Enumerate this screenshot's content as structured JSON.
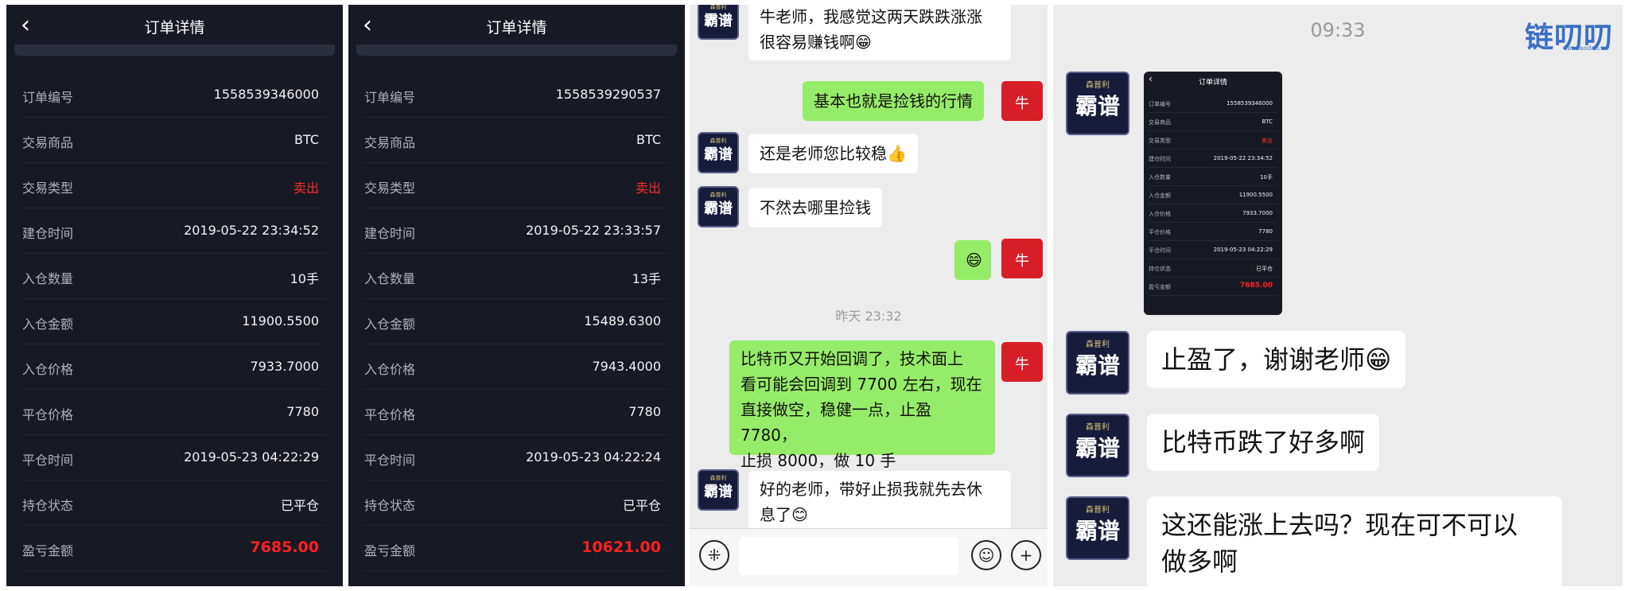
{
  "order1": {
    "back_icon": "chevron-left-icon",
    "title": "订单详情",
    "rows": [
      {
        "k": "订单编号",
        "v": "1558539346000"
      },
      {
        "k": "交易商品",
        "v": "BTC"
      },
      {
        "k": "交易类型",
        "v": "卖出"
      },
      {
        "k": "建仓时间",
        "v": "2019-05-22 23:34:52"
      },
      {
        "k": "入仓数量",
        "v": "10手"
      },
      {
        "k": "入仓金额",
        "v": "11900.5500"
      },
      {
        "k": "入仓价格",
        "v": "7933.7000"
      },
      {
        "k": "平仓价格",
        "v": "7780"
      },
      {
        "k": "平仓时间",
        "v": "2019-05-23 04:22:29"
      },
      {
        "k": "持仓状态",
        "v": "已平仓"
      },
      {
        "k": "盈亏金额",
        "v": "7685.00"
      }
    ]
  },
  "order2": {
    "back_icon": "chevron-left-icon",
    "title": "订单详情",
    "rows": [
      {
        "k": "订单编号",
        "v": "1558539290537"
      },
      {
        "k": "交易商品",
        "v": "BTC"
      },
      {
        "k": "交易类型",
        "v": "卖出"
      },
      {
        "k": "建仓时间",
        "v": "2019-05-22 23:33:57"
      },
      {
        "k": "入仓数量",
        "v": "13手"
      },
      {
        "k": "入仓金额",
        "v": "15489.6300"
      },
      {
        "k": "入仓价格",
        "v": "7943.4000"
      },
      {
        "k": "平仓价格",
        "v": "7780"
      },
      {
        "k": "平仓时间",
        "v": "2019-05-23 04:22:24"
      },
      {
        "k": "持仓状态",
        "v": "已平仓"
      },
      {
        "k": "盈亏金额",
        "v": "10621.00"
      }
    ]
  },
  "chat3": {
    "avatar_text": "霸谱",
    "avatar_sub": "森普利",
    "bot_icon": "牛",
    "messages": [
      {
        "l1": "牛老师，我感觉这两天跌跌涨涨",
        "l2": "很容易赚钱啊😁"
      },
      {
        "text": "基本也就是捡钱的行情"
      },
      {
        "text": "还是老师您比较稳👍"
      },
      {
        "text": "不然去哪里捡钱"
      },
      {
        "text": "😄"
      },
      {
        "l1": "比特币又开始回调了，技术面上",
        "l2": "看可能会回调到 7700 左右，现在",
        "l3": "直接做空，稳健一点，止盈 7780，",
        "l4": "止损 8000，做 10 手"
      },
      {
        "l1": "好的老师，带好止损我就先去休",
        "l2": "息了😊"
      }
    ],
    "timestamp": "昨天 23:32",
    "voice_icon": "voice-icon",
    "emoji_icon": "emoji-icon",
    "plus_icon": "plus-icon"
  },
  "chat4": {
    "time": "09:33",
    "logo_text": "链叨叨",
    "logo_sub": "liandaodao.cn",
    "avatar_text": "霸谱",
    "avatar_sub": "森普利",
    "mini_title": "订单详情",
    "messages": [
      {
        "text": "止盈了，谢谢老师😁"
      },
      {
        "text": "比特币跌了好多啊"
      },
      {
        "l1": "这还能涨上去吗？现在可不可以",
        "l2": "做多啊"
      }
    ]
  }
}
